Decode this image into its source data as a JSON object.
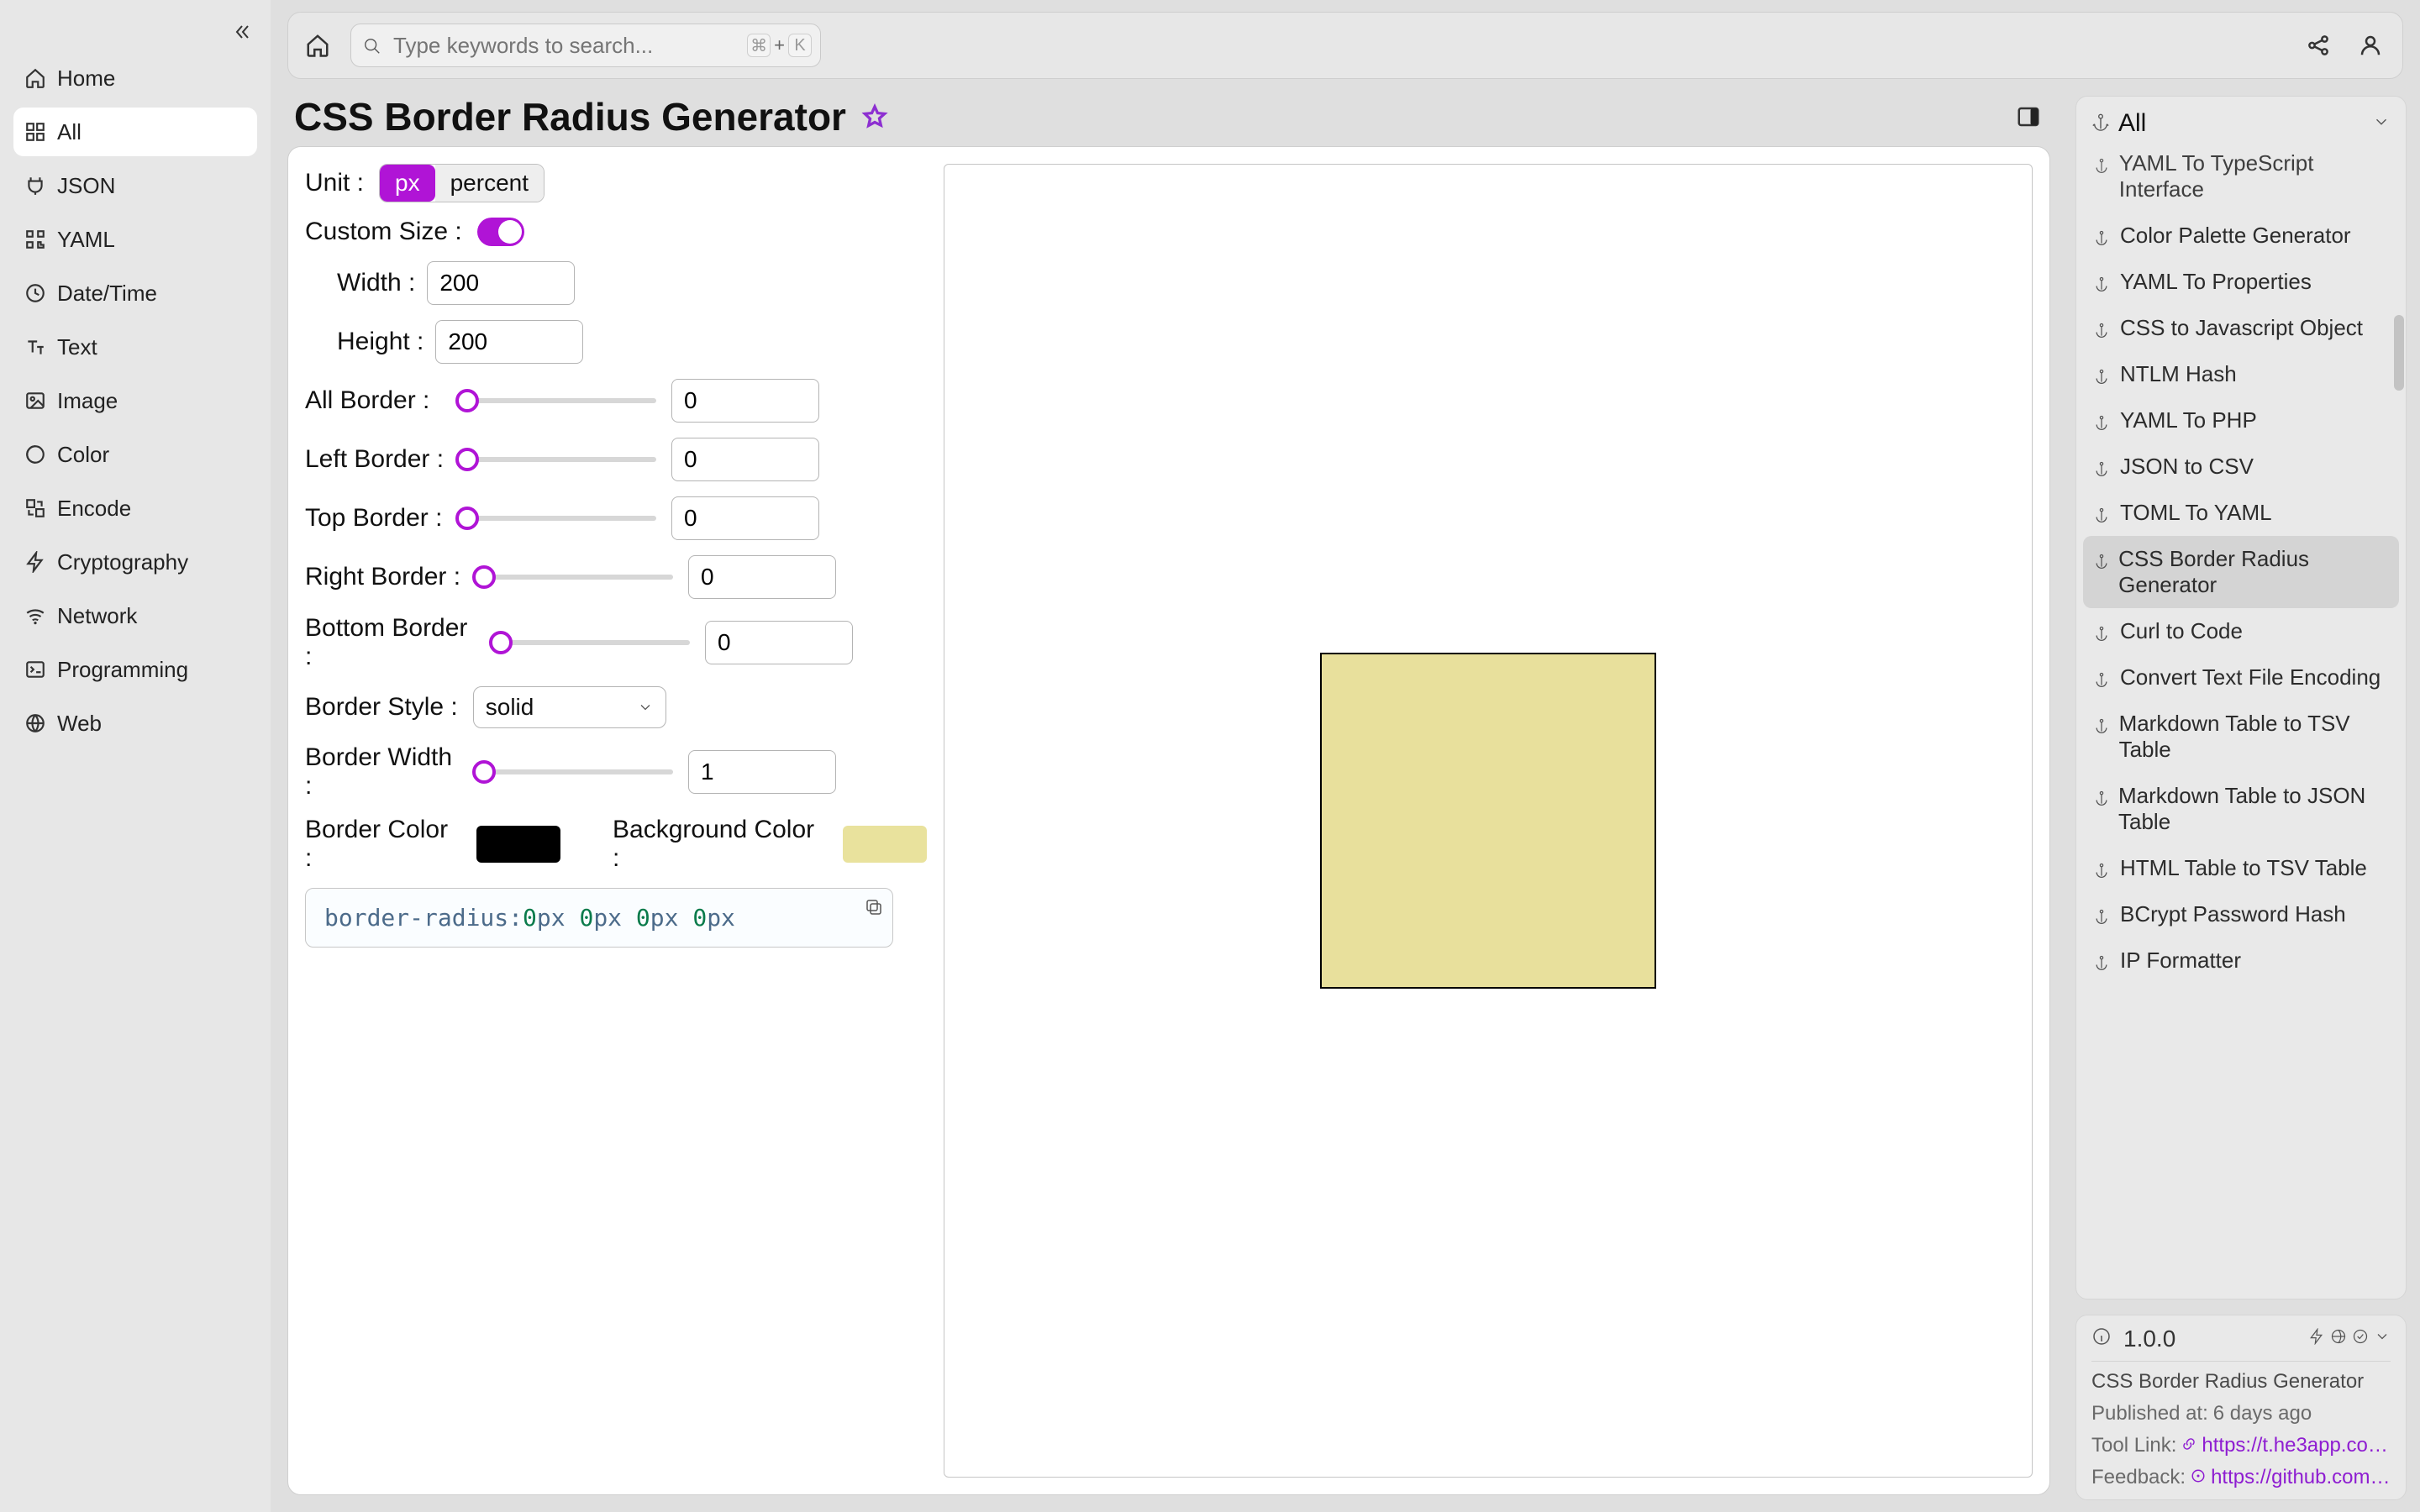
{
  "search": {
    "placeholder": "Type keywords to search...",
    "shortcut_symbol": "⌘",
    "shortcut_plus": "+",
    "shortcut_key": "K"
  },
  "nav": {
    "home": "Home",
    "all": "All",
    "json": "JSON",
    "yaml": "YAML",
    "datetime": "Date/Time",
    "text": "Text",
    "image": "Image",
    "color": "Color",
    "encode": "Encode",
    "cryptography": "Cryptography",
    "network": "Network",
    "programming": "Programming",
    "web": "Web"
  },
  "page": {
    "title": "CSS Border Radius Generator"
  },
  "form": {
    "unit_label": "Unit :",
    "unit_px": "px",
    "unit_percent": "percent",
    "custom_size_label": "Custom Size :",
    "width_label": "Width :",
    "width_value": "200",
    "height_label": "Height :",
    "height_value": "200",
    "all_border_label": "All Border :",
    "all_border_value": "0",
    "left_border_label": "Left Border :",
    "left_border_value": "0",
    "top_border_label": "Top Border :",
    "top_border_value": "0",
    "right_border_label": "Right Border :",
    "right_border_value": "0",
    "bottom_border_label": "Bottom Border :",
    "bottom_border_value": "0",
    "border_style_label": "Border Style :",
    "border_style_value": "solid",
    "border_width_label": "Border Width :",
    "border_width_value": "1",
    "border_color_label": "Border Color :",
    "background_color_label": "Background Color :"
  },
  "css_output": "border-radius:0px 0px 0px 0px",
  "code_parts": {
    "prop": "border-radius:",
    "v1n": "0",
    "v1u": "px",
    "v2n": " 0",
    "v2u": "px",
    "v3n": " 0",
    "v3u": "px",
    "v4n": " 0",
    "v4u": "px"
  },
  "colors": {
    "border_hex": "#000000",
    "background_hex": "#e8e09c",
    "accent": "#b014d6"
  },
  "right_header": "All",
  "tools": {
    "yaml_ts": "YAML To TypeScript Interface",
    "color_palette": "Color Palette Generator",
    "yaml_props": "YAML To Properties",
    "css_js": "CSS to Javascript Object",
    "ntlm": "NTLM Hash",
    "yaml_php": "YAML To PHP",
    "json_csv": "JSON to CSV",
    "toml_yaml": "TOML To YAML",
    "css_br": "CSS Border Radius Generator",
    "curl_code": "Curl to Code",
    "convert_enc": "Convert Text File Encoding",
    "md_tsv": "Markdown Table to TSV Table",
    "md_json": "Markdown Table to JSON Table",
    "html_tsv": "HTML Table to TSV Table",
    "bcrypt": "BCrypt Password Hash",
    "ip_fmt": "IP Formatter"
  },
  "info": {
    "version": "1.0.0",
    "tool_name": "CSS Border Radius Generator",
    "published_label": "Published at:",
    "published_value": "6 days ago",
    "tool_link_label": "Tool Link:",
    "tool_link_url": "https://t.he3app.co…",
    "feedback_label": "Feedback:",
    "feedback_url": "https://github.com/…"
  }
}
